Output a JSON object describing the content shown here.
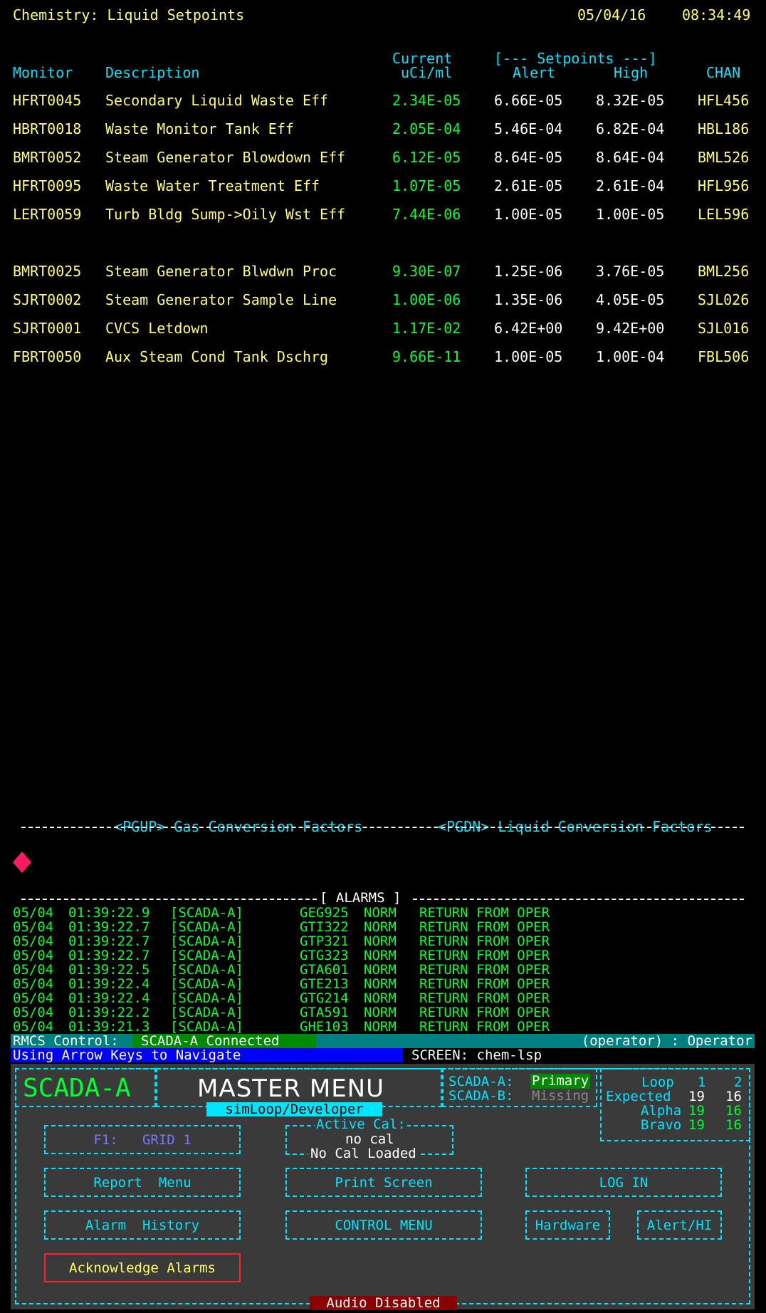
{
  "header": {
    "title": "Chemistry: Liquid Setpoints",
    "date": "05/04/16",
    "time": "08:34:49"
  },
  "table": {
    "col_monitor": "Monitor",
    "col_description": "Description",
    "col_current_1": "Current",
    "col_current_2": "uCi/ml",
    "setpoints_header": "[--- Setpoints ---]",
    "col_alert": "Alert",
    "col_high": "High",
    "col_chan": "CHAN",
    "group1": [
      {
        "monitor": "HFRT0045",
        "description": "Secondary Liquid Waste Eff",
        "current": "2.34E-05",
        "alert": "6.66E-05",
        "high": "8.32E-05",
        "chan": "HFL456"
      },
      {
        "monitor": "HBRT0018",
        "description": "Waste Monitor Tank Eff",
        "current": "2.05E-04",
        "alert": "5.46E-04",
        "high": "6.82E-04",
        "chan": "HBL186"
      },
      {
        "monitor": "BMRT0052",
        "description": "Steam Generator Blowdown Eff",
        "current": "6.12E-05",
        "alert": "8.64E-05",
        "high": "8.64E-04",
        "chan": "BML526"
      },
      {
        "monitor": "HFRT0095",
        "description": "Waste Water Treatment Eff",
        "current": "1.07E-05",
        "alert": "2.61E-05",
        "high": "2.61E-04",
        "chan": "HFL956"
      },
      {
        "monitor": "LERT0059",
        "description": "Turb Bldg Sump->Oily Wst Eff",
        "current": "7.44E-06",
        "alert": "1.00E-05",
        "high": "1.00E-05",
        "chan": "LEL596"
      }
    ],
    "group2": [
      {
        "monitor": "BMRT0025",
        "description": "Steam Generator Blwdwn Proc",
        "current": "9.30E-07",
        "alert": "1.25E-06",
        "high": "3.76E-05",
        "chan": "BML256"
      },
      {
        "monitor": "SJRT0002",
        "description": "Steam Generator Sample Line",
        "current": "1.00E-06",
        "alert": "1.35E-06",
        "high": "4.05E-05",
        "chan": "SJL026"
      },
      {
        "monitor": "SJRT0001",
        "description": "CVCS Letdown",
        "current": "1.17E-02",
        "alert": "6.42E+00",
        "high": "9.42E+00",
        "chan": "SJL016"
      },
      {
        "monitor": "FBRT0050",
        "description": "Aux Steam Cond Tank Dschrg",
        "current": "9.66E-11",
        "alert": "1.00E-05",
        "high": "1.00E-04",
        "chan": "FBL506"
      }
    ]
  },
  "nav": {
    "pgup_key": "<PGUP>",
    "pgup_label": "Gas Conversion Factors",
    "pgdn_key": "<PGDN>",
    "pgdn_label": "Liquid Conversion Factors"
  },
  "alarms": {
    "title": "[ ALARMS ]",
    "rows": [
      {
        "date": "05/04",
        "time": "01:39:22.9",
        "source": "[SCADA-A]",
        "point": "GEG925",
        "state": "NORM",
        "message": "RETURN FROM OPER"
      },
      {
        "date": "05/04",
        "time": "01:39:22.7",
        "source": "[SCADA-A]",
        "point": "GTI322",
        "state": "NORM",
        "message": "RETURN FROM OPER"
      },
      {
        "date": "05/04",
        "time": "01:39:22.7",
        "source": "[SCADA-A]",
        "point": "GTP321",
        "state": "NORM",
        "message": "RETURN FROM OPER"
      },
      {
        "date": "05/04",
        "time": "01:39:22.7",
        "source": "[SCADA-A]",
        "point": "GTG323",
        "state": "NORM",
        "message": "RETURN FROM OPER"
      },
      {
        "date": "05/04",
        "time": "01:39:22.5",
        "source": "[SCADA-A]",
        "point": "GTA601",
        "state": "NORM",
        "message": "RETURN FROM OPER"
      },
      {
        "date": "05/04",
        "time": "01:39:22.4",
        "source": "[SCADA-A]",
        "point": "GTE213",
        "state": "NORM",
        "message": "RETURN FROM OPER"
      },
      {
        "date": "05/04",
        "time": "01:39:22.4",
        "source": "[SCADA-A]",
        "point": "GTG214",
        "state": "NORM",
        "message": "RETURN FROM OPER"
      },
      {
        "date": "05/04",
        "time": "01:39:22.2",
        "source": "[SCADA-A]",
        "point": "GTA591",
        "state": "NORM",
        "message": "RETURN FROM OPER"
      },
      {
        "date": "05/04",
        "time": "01:39:21.3",
        "source": "[SCADA-A]",
        "point": "GHE103",
        "state": "NORM",
        "message": "RETURN FROM OPER"
      }
    ]
  },
  "status": {
    "rmcs_label": "RMCS Control:",
    "rmcs_value": "SCADA-A Connected",
    "user": "(operator) : Operator",
    "hint": "Using Arrow Keys to Navigate",
    "screen": "SCREEN: chem-lsp"
  },
  "menu": {
    "system": "SCADA-A",
    "title": "MASTER MENU",
    "subtitle": "simLoop/Developer",
    "scada_a_label": "SCADA-A:",
    "scada_a_value": "Primary",
    "scada_b_label": "SCADA-B:",
    "scada_b_value": "Missing",
    "loop_label": "Loop",
    "loop_1": "1",
    "loop_2": "2",
    "expected_label": "Expected",
    "expected_1": "19",
    "expected_2": "16",
    "alpha_label": "Alpha",
    "alpha_1": "19",
    "alpha_2": "16",
    "bravo_label": "Bravo",
    "bravo_1": "19",
    "bravo_2": "16",
    "active_cal_label": "Active Cal:",
    "active_cal_value": "no cal",
    "active_cal_status": "No Cal Loaded",
    "f1_button": "F1:   GRID 1",
    "report_menu": "Report  Menu",
    "print_screen": "Print Screen",
    "log_in": "LOG IN",
    "alarm_history": "Alarm  History",
    "control_menu": "CONTROL MENU",
    "hardware": "Hardware",
    "alert_hi": "Alert/HI",
    "acknowledge": "Acknowledge Alarms",
    "audio": "Audio Disabled"
  }
}
